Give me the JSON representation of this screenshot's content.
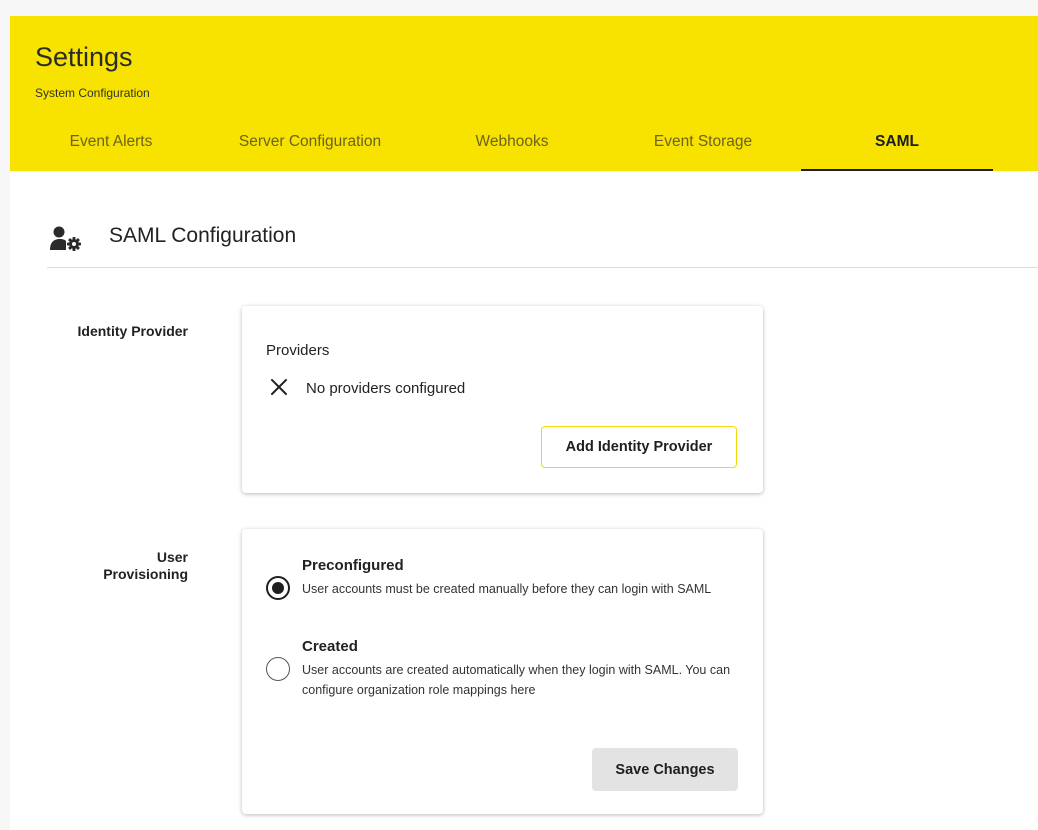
{
  "header": {
    "title": "Settings",
    "subtitle": "System Configuration",
    "tabs": [
      {
        "label": "Event Alerts"
      },
      {
        "label": "Server Configuration"
      },
      {
        "label": "Webhooks"
      },
      {
        "label": "Event Storage"
      },
      {
        "label": "SAML",
        "active": true
      }
    ]
  },
  "section": {
    "title": "SAML Configuration",
    "icon": "user-gear-icon"
  },
  "identity_provider": {
    "label": "Identity Provider",
    "providers_label": "Providers",
    "status_icon": "close-icon",
    "status_text": "No providers configured",
    "add_button": "Add Identity Provider"
  },
  "user_provisioning": {
    "label": "User Provisioning",
    "options": [
      {
        "title": "Preconfigured",
        "description": "User accounts must be created manually before they can login with SAML",
        "selected": true
      },
      {
        "title": "Created",
        "description": "User accounts are created automatically when they login with SAML. You can configure organization role mappings here",
        "selected": false
      }
    ],
    "save_button": "Save Changes"
  },
  "colors": {
    "header_bg": "#f7e200",
    "accent_border": "#f2d90a",
    "save_button_bg": "#e3e3e3"
  }
}
